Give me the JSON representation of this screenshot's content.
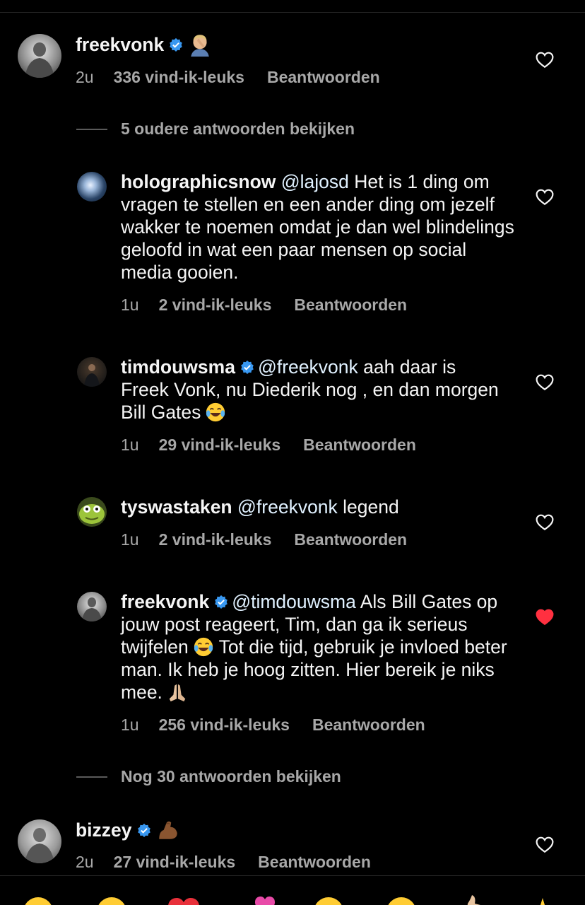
{
  "comments": [
    {
      "username": "freekvonk",
      "verified": true,
      "text": "",
      "emoji_icon": "facepalm-icon",
      "time": "2u",
      "likes": "336 vind-ik-leuks",
      "reply": "Beantwoorden",
      "liked": false
    },
    {
      "username": "holographicsnow",
      "mention": "@lajosd",
      "text": " Het is 1 ding om vragen te stellen en een ander ding om jezelf wakker te noemen omdat je dan wel blindelings geloofd in wat een paar mensen op social media gooien.",
      "time": "1u",
      "likes": "2 vind-ik-leuks",
      "reply": "Beantwoorden",
      "liked": false
    },
    {
      "username": "timdouwsma",
      "verified": true,
      "mention": "@freekvonk",
      "text": " aah daar is Freek Vonk, nu Diederik nog , en dan morgen Bill Gates",
      "emoji_icon": "laughing-tears-icon",
      "time": "1u",
      "likes": "29 vind-ik-leuks",
      "reply": "Beantwoorden",
      "liked": false
    },
    {
      "username": "tyswastaken",
      "mention": "@freekvonk",
      "text": " legend",
      "time": "1u",
      "likes": "2 vind-ik-leuks",
      "reply": "Beantwoorden",
      "liked": false
    },
    {
      "username": "freekvonk",
      "verified": true,
      "mention": "@timdouwsma",
      "text_a": " Als Bill Gates op jouw post reageert, Tim, dan ga ik serieus twijfelen",
      "text_b": " Tot die tijd, gebruik je invloed beter man. Ik heb je hoog zitten. Hier bereik je niks mee.",
      "time": "1u",
      "likes": "256 vind-ik-leuks",
      "reply": "Beantwoorden",
      "liked": true
    },
    {
      "username": "bizzey",
      "verified": true,
      "emoji_icon": "flexed-biceps-icon",
      "time": "2u",
      "likes": "27 vind-ik-leuks",
      "reply": "Beantwoorden",
      "liked": false
    }
  ],
  "view_older": "5 oudere antwoorden bekijken",
  "view_more": "Nog 30 antwoorden bekijken",
  "colors": {
    "background": "#000000",
    "text": "#f5f5f5",
    "secondary": "#a8a8a8",
    "verified": "#3897f0",
    "liked_heart": "#ff3040"
  }
}
